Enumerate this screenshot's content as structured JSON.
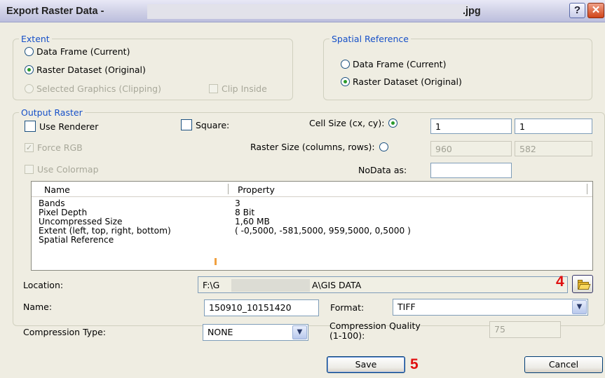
{
  "window": {
    "title": "Export Raster Data -",
    "title_suffix": ".jpg",
    "help_label": "?",
    "close_label": "✕"
  },
  "extent": {
    "legend": "Extent",
    "data_frame": "Data Frame (Current)",
    "raster_dataset": "Raster Dataset (Original)",
    "selected_graphics": "Selected Graphics (Clipping)",
    "clip_inside": "Clip Inside"
  },
  "spatial_reference": {
    "legend": "Spatial Reference",
    "data_frame": "Data Frame (Current)",
    "raster_dataset": "Raster Dataset (Original)"
  },
  "output": {
    "legend": "Output Raster",
    "use_renderer": "Use Renderer",
    "square": "Square:",
    "cell_size_label": "Cell Size (cx, cy):",
    "cell_x": "1",
    "cell_y": "1",
    "force_rgb": "Force RGB",
    "force_rgb_check": "✓",
    "raster_size_label": "Raster Size (columns, rows):",
    "columns": "960",
    "rows": "582",
    "use_colormap": "Use Colormap",
    "nodata_label": "NoData as:",
    "nodata_value": ""
  },
  "properties": {
    "header_name": "Name",
    "header_property": "Property",
    "rows": [
      {
        "name": "Bands",
        "value": "3"
      },
      {
        "name": "Pixel Depth",
        "value": "8 Bit"
      },
      {
        "name": "Uncompressed Size",
        "value": "1,60 MB"
      },
      {
        "name": "Extent (left, top, right, bottom)",
        "value": "( -0,5000, -581,5000, 959,5000, 0,5000 )"
      },
      {
        "name": "Spatial Reference",
        "value": ""
      }
    ]
  },
  "location": {
    "label": "Location:",
    "prefix": "F:\\G",
    "suffix": "A\\GIS DATA"
  },
  "name": {
    "label": "Name:",
    "value": "150910_10151420"
  },
  "format": {
    "label": "Format:",
    "value": "TIFF"
  },
  "compression": {
    "type_label": "Compression Type:",
    "type_value": "NONE",
    "quality_label_1": "Compression Quality",
    "quality_label_2": "(1-100):",
    "quality_value": "75"
  },
  "buttons": {
    "save": "Save",
    "cancel": "Cancel"
  },
  "annotations": {
    "folder_step": "4",
    "save_step": "5",
    "color": "#e01010"
  }
}
